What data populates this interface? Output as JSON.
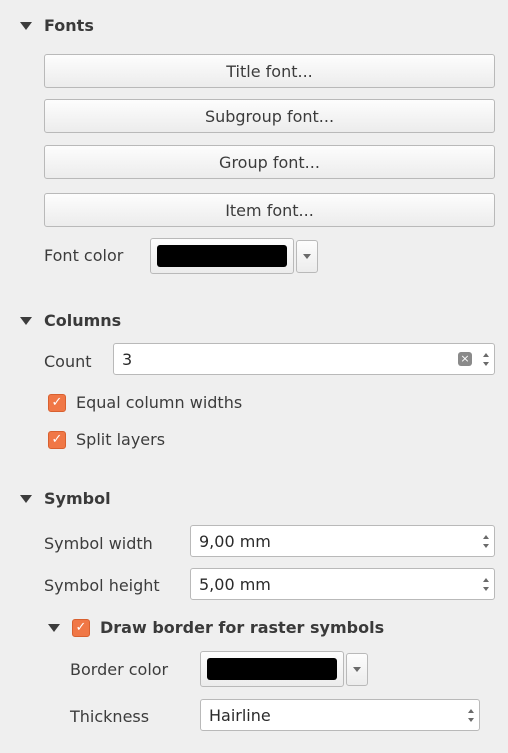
{
  "fonts": {
    "header": "Fonts",
    "title_font": "Title font...",
    "subgroup_font": "Subgroup font...",
    "group_font": "Group font...",
    "item_font": "Item font...",
    "font_color_label": "Font color",
    "font_color": "#000000"
  },
  "columns": {
    "header": "Columns",
    "count_label": "Count",
    "count_value": "3",
    "equal_widths_label": "Equal column widths",
    "equal_widths_checked": true,
    "split_layers_label": "Split layers",
    "split_layers_checked": true
  },
  "symbol": {
    "header": "Symbol",
    "width_label": "Symbol width",
    "width_value": "9,00 mm",
    "height_label": "Symbol height",
    "height_value": "5,00 mm",
    "draw_border_label": "Draw border for raster symbols",
    "draw_border_checked": true,
    "border_color_label": "Border color",
    "border_color": "#000000",
    "thickness_label": "Thickness",
    "thickness_value": "Hairline"
  },
  "colors": {
    "accent": "#f07746",
    "background": "#efefef"
  },
  "icons": {
    "collapse": "triangle-down-icon",
    "check": "checkmark-icon",
    "clear": "clear-icon"
  }
}
